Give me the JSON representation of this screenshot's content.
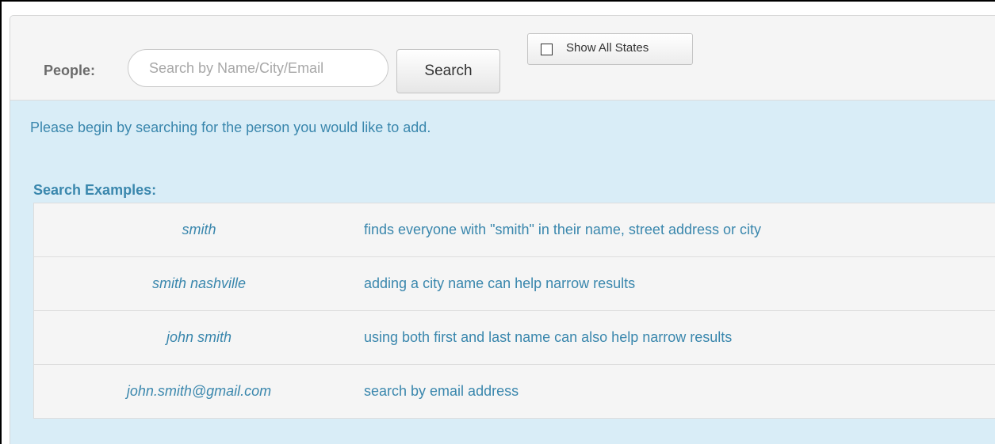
{
  "search": {
    "label": "People:",
    "placeholder": "Search by Name/City/Email",
    "value": "",
    "button_label": "Search"
  },
  "show_all_states": {
    "label": "Show All States",
    "checked": false
  },
  "info": {
    "message": "Please begin by searching for the person you would like to add."
  },
  "examples": {
    "heading": "Search Examples:",
    "rows": [
      {
        "query": "smith",
        "description": "finds everyone with \"smith\" in their name, street address or city"
      },
      {
        "query": "smith nashville",
        "description": "adding a city name can help narrow results"
      },
      {
        "query": "john smith",
        "description": "using both first and last name can also help narrow results"
      },
      {
        "query": "john.smith@gmail.com",
        "description": "search by email address"
      }
    ]
  },
  "colors": {
    "info_background": "#d9edf7",
    "info_text": "#3a87ad",
    "toolbar_background": "#f5f5f5"
  }
}
